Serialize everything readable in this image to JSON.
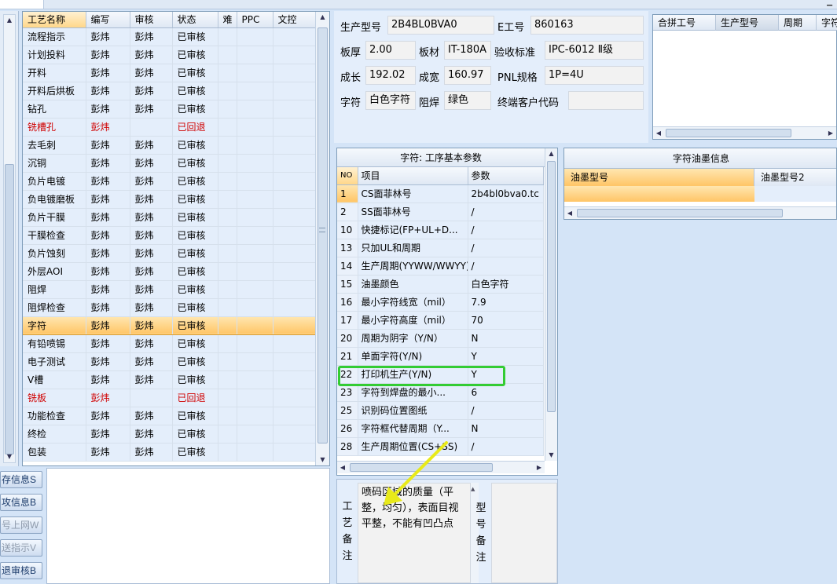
{
  "process_grid": {
    "columns": [
      "工艺名称",
      "编写",
      "审核",
      "状态",
      "难",
      "PPC",
      "文控"
    ],
    "rows": [
      {
        "name": "流程指示",
        "author": "彭炜",
        "reviewer": "彭炜",
        "status": "已审核"
      },
      {
        "name": "计划投料",
        "author": "彭炜",
        "reviewer": "彭炜",
        "status": "已审核"
      },
      {
        "name": "开料",
        "author": "彭炜",
        "reviewer": "彭炜",
        "status": "已审核"
      },
      {
        "name": "开料后烘板",
        "author": "彭炜",
        "reviewer": "彭炜",
        "status": "已审核"
      },
      {
        "name": "钻孔",
        "author": "彭炜",
        "reviewer": "彭炜",
        "status": "已审核"
      },
      {
        "name": "铣槽孔",
        "author": "彭炜",
        "reviewer": "",
        "status": "已回退"
      },
      {
        "name": "去毛刺",
        "author": "彭炜",
        "reviewer": "彭炜",
        "status": "已审核"
      },
      {
        "name": "沉铜",
        "author": "彭炜",
        "reviewer": "彭炜",
        "status": "已审核"
      },
      {
        "name": "负片电镀",
        "author": "彭炜",
        "reviewer": "彭炜",
        "status": "已审核"
      },
      {
        "name": "负电镀磨板",
        "author": "彭炜",
        "reviewer": "彭炜",
        "status": "已审核"
      },
      {
        "name": "负片干膜",
        "author": "彭炜",
        "reviewer": "彭炜",
        "status": "已审核"
      },
      {
        "name": "干膜检查",
        "author": "彭炜",
        "reviewer": "彭炜",
        "status": "已审核"
      },
      {
        "name": "负片蚀刻",
        "author": "彭炜",
        "reviewer": "彭炜",
        "status": "已审核"
      },
      {
        "name": "外层AOI",
        "author": "彭炜",
        "reviewer": "彭炜",
        "status": "已审核"
      },
      {
        "name": "阻焊",
        "author": "彭炜",
        "reviewer": "彭炜",
        "status": "已审核"
      },
      {
        "name": "阻焊检查",
        "author": "彭炜",
        "reviewer": "彭炜",
        "status": "已审核"
      },
      {
        "name": "字符",
        "author": "彭炜",
        "reviewer": "彭炜",
        "status": "已审核"
      },
      {
        "name": "有铅喷锡",
        "author": "彭炜",
        "reviewer": "彭炜",
        "status": "已审核"
      },
      {
        "name": "电子测试",
        "author": "彭炜",
        "reviewer": "彭炜",
        "status": "已审核"
      },
      {
        "name": "V槽",
        "author": "彭炜",
        "reviewer": "彭炜",
        "status": "已审核"
      },
      {
        "name": "铣板",
        "author": "彭炜",
        "reviewer": "",
        "status": "已回退"
      },
      {
        "name": "功能检查",
        "author": "彭炜",
        "reviewer": "彭炜",
        "status": "已审核"
      },
      {
        "name": "终检",
        "author": "彭炜",
        "reviewer": "彭炜",
        "status": "已审核"
      },
      {
        "name": "包装",
        "author": "彭炜",
        "reviewer": "彭炜",
        "status": "已审核"
      }
    ]
  },
  "side_buttons": [
    "存信息S",
    "攻信息B",
    "号上网W",
    "送指示V",
    "退审核B"
  ],
  "info": {
    "model_label": "生产型号",
    "model_value": "2B4BL0BVA0",
    "e_label": "E工号",
    "e_value": "860163",
    "thickness_label": "板厚",
    "thickness_value": "2.00",
    "material_label": "板材",
    "material_value": "IT-180A",
    "standard_label": "验收标准",
    "standard_value": "IPC-6012 Ⅱ级",
    "length_label": "成长",
    "length_value": "192.02",
    "width_label": "成宽",
    "width_value": "160.97",
    "pnl_label": "PNL规格",
    "pnl_value": "1P=4U",
    "char_label": "字符",
    "char_value": "白色字符",
    "mask_label": "阻焊",
    "mask_value": "绿色",
    "customer_label": "终端客户代码",
    "customer_value": ""
  },
  "merge_panel": {
    "columns": [
      "合拼工号",
      "生产型号",
      "周期",
      "字符"
    ]
  },
  "param_panel": {
    "title": "字符: 工序基本参数",
    "columns": [
      "NO",
      "项目",
      "参数"
    ],
    "rows": [
      {
        "no": "1",
        "item": "CS面菲林号",
        "value": "2b4bl0bva0.tc"
      },
      {
        "no": "2",
        "item": "SS面菲林号",
        "value": "/"
      },
      {
        "no": "10",
        "item": "快捷标记(FP+UL+D...",
        "value": "/"
      },
      {
        "no": "13",
        "item": "只加UL和周期",
        "value": "/"
      },
      {
        "no": "14",
        "item": "生产周期(YYWW/WWYY)",
        "value": "/"
      },
      {
        "no": "15",
        "item": "油墨颜色",
        "value": "白色字符"
      },
      {
        "no": "16",
        "item": "最小字符线宽（mil）",
        "value": "7.9"
      },
      {
        "no": "17",
        "item": "最小字符高度（mil）",
        "value": "70"
      },
      {
        "no": "20",
        "item": "周期为阴字（Y/N）",
        "value": "N"
      },
      {
        "no": "21",
        "item": "单面字符(Y/N)",
        "value": "Y"
      },
      {
        "no": "22",
        "item": "打印机生产(Y/N)",
        "value": "Y"
      },
      {
        "no": "23",
        "item": "字符到焊盘的最小...",
        "value": "6"
      },
      {
        "no": "25",
        "item": "识别码位置图纸",
        "value": "/"
      },
      {
        "no": "26",
        "item": "字符框代替周期（Y...",
        "value": "N"
      },
      {
        "no": "28",
        "item": "生产周期位置(CS+SS)",
        "value": "/"
      }
    ]
  },
  "ink_panel": {
    "title": "字符油墨信息",
    "columns": [
      "油墨型号",
      "油墨型号2"
    ]
  },
  "remarks": {
    "process_label": "工艺备注",
    "process_text": "喷码区域的质量（平整，均匀），表面目视平整，不能有凹凸点",
    "type_label": "型号备注"
  },
  "colors": {
    "highlight_box": "#33cc33",
    "annotation_arrow": "#e8ea1a",
    "rollback_text": "#d00000",
    "selected_row": "#ffc566"
  }
}
